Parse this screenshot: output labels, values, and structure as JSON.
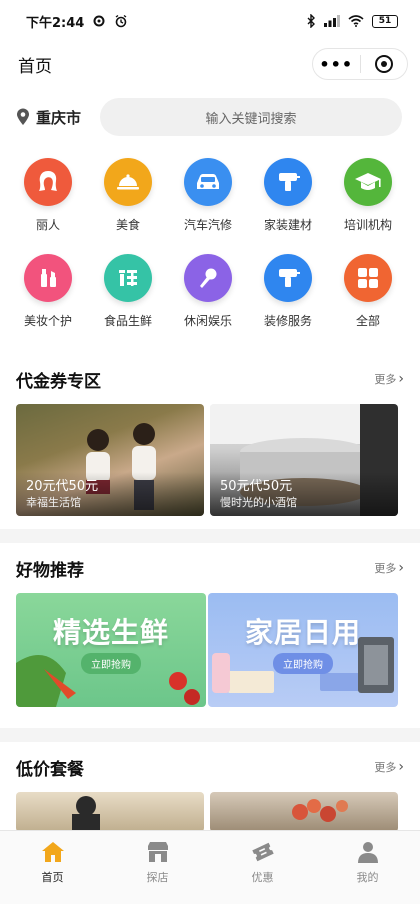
{
  "status_bar": {
    "time": "下午2:44",
    "battery": "51"
  },
  "nav": {
    "title": "首页",
    "more_glyph": "•••"
  },
  "search": {
    "city": "重庆市",
    "placeholder": "输入关键词搜索"
  },
  "categories": [
    {
      "label": "丽人",
      "icon": "woman-face-icon",
      "color": "#ef5a3c"
    },
    {
      "label": "美食",
      "icon": "food-cloche-icon",
      "color": "#f2a71b"
    },
    {
      "label": "汽车汽修",
      "icon": "car-icon",
      "color": "#3a8ff0"
    },
    {
      "label": "家装建材",
      "icon": "drill-icon",
      "color": "#2f86ef"
    },
    {
      "label": "培训机构",
      "icon": "graduation-cap-icon",
      "color": "#54b63b"
    },
    {
      "label": "美妆个护",
      "icon": "cosmetics-icon",
      "color": "#f2537d"
    },
    {
      "label": "食品生鲜",
      "icon": "fresh-food-icon",
      "color": "#35c3a6"
    },
    {
      "label": "休闲娱乐",
      "icon": "microphone-icon",
      "color": "#8b63e6"
    },
    {
      "label": "装修服务",
      "icon": "paint-roller-icon",
      "color": "#2f86ef"
    },
    {
      "label": "全部",
      "icon": "grid-icon",
      "color": "#f06532"
    }
  ],
  "voucher_section": {
    "title": "代金券专区",
    "more": "更多",
    "cards": [
      {
        "price": "20元代50元",
        "shop": "幸福生活馆"
      },
      {
        "price": "50元代50元",
        "shop": "慢时光的小酒馆"
      }
    ]
  },
  "goods_section": {
    "title": "好物推荐",
    "more": "更多",
    "banners": [
      {
        "title": "精选生鲜",
        "button": "立即抢购"
      },
      {
        "title": "家居日用",
        "button": "立即抢购"
      }
    ]
  },
  "combo_section": {
    "title": "低价套餐",
    "more": "更多"
  },
  "tabs": [
    {
      "label": "首页",
      "icon": "home-icon",
      "active": true
    },
    {
      "label": "探店",
      "icon": "shop-icon",
      "active": false
    },
    {
      "label": "优惠",
      "icon": "ticket-icon",
      "active": false
    },
    {
      "label": "我的",
      "icon": "user-icon",
      "active": false
    }
  ],
  "colors": {
    "accent_orange": "#f2a71b",
    "background": "#f4f4f4"
  }
}
